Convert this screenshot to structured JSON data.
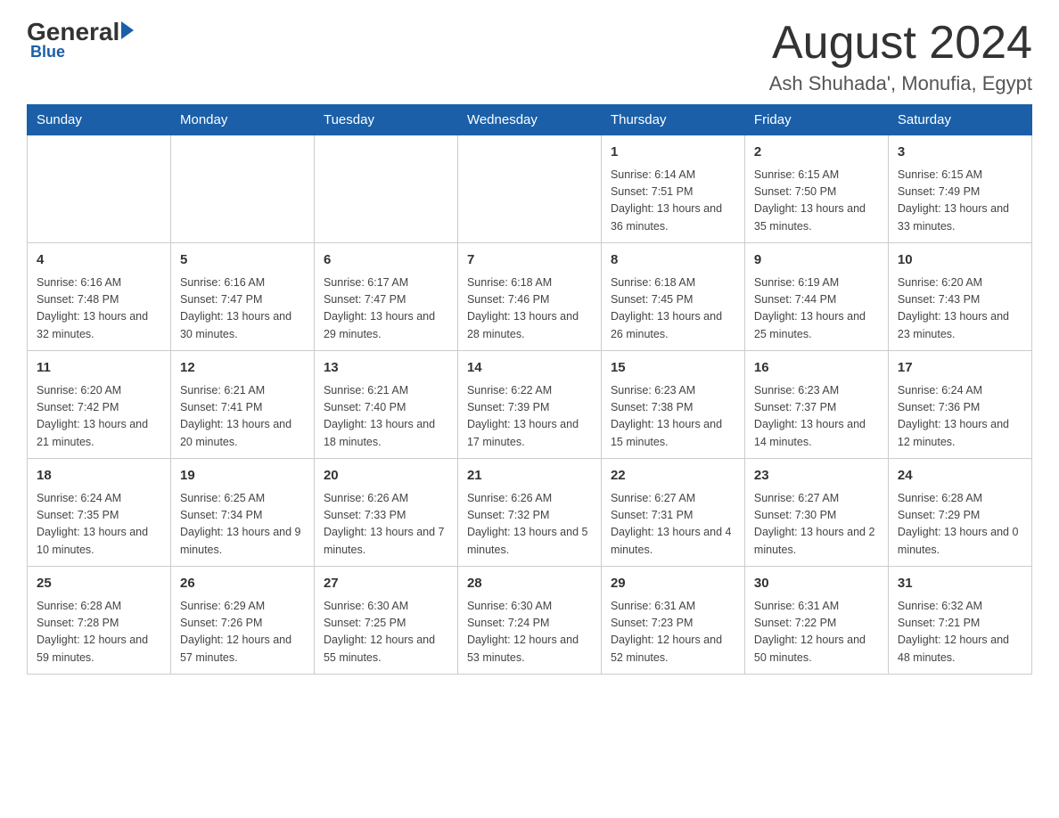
{
  "header": {
    "logo_general": "General",
    "logo_blue": "Blue",
    "month_title": "August 2024",
    "location": "Ash Shuhada', Monufia, Egypt"
  },
  "weekdays": [
    "Sunday",
    "Monday",
    "Tuesday",
    "Wednesday",
    "Thursday",
    "Friday",
    "Saturday"
  ],
  "weeks": [
    [
      {
        "day": "",
        "info": ""
      },
      {
        "day": "",
        "info": ""
      },
      {
        "day": "",
        "info": ""
      },
      {
        "day": "",
        "info": ""
      },
      {
        "day": "1",
        "info": "Sunrise: 6:14 AM\nSunset: 7:51 PM\nDaylight: 13 hours\nand 36 minutes."
      },
      {
        "day": "2",
        "info": "Sunrise: 6:15 AM\nSunset: 7:50 PM\nDaylight: 13 hours\nand 35 minutes."
      },
      {
        "day": "3",
        "info": "Sunrise: 6:15 AM\nSunset: 7:49 PM\nDaylight: 13 hours\nand 33 minutes."
      }
    ],
    [
      {
        "day": "4",
        "info": "Sunrise: 6:16 AM\nSunset: 7:48 PM\nDaylight: 13 hours\nand 32 minutes."
      },
      {
        "day": "5",
        "info": "Sunrise: 6:16 AM\nSunset: 7:47 PM\nDaylight: 13 hours\nand 30 minutes."
      },
      {
        "day": "6",
        "info": "Sunrise: 6:17 AM\nSunset: 7:47 PM\nDaylight: 13 hours\nand 29 minutes."
      },
      {
        "day": "7",
        "info": "Sunrise: 6:18 AM\nSunset: 7:46 PM\nDaylight: 13 hours\nand 28 minutes."
      },
      {
        "day": "8",
        "info": "Sunrise: 6:18 AM\nSunset: 7:45 PM\nDaylight: 13 hours\nand 26 minutes."
      },
      {
        "day": "9",
        "info": "Sunrise: 6:19 AM\nSunset: 7:44 PM\nDaylight: 13 hours\nand 25 minutes."
      },
      {
        "day": "10",
        "info": "Sunrise: 6:20 AM\nSunset: 7:43 PM\nDaylight: 13 hours\nand 23 minutes."
      }
    ],
    [
      {
        "day": "11",
        "info": "Sunrise: 6:20 AM\nSunset: 7:42 PM\nDaylight: 13 hours\nand 21 minutes."
      },
      {
        "day": "12",
        "info": "Sunrise: 6:21 AM\nSunset: 7:41 PM\nDaylight: 13 hours\nand 20 minutes."
      },
      {
        "day": "13",
        "info": "Sunrise: 6:21 AM\nSunset: 7:40 PM\nDaylight: 13 hours\nand 18 minutes."
      },
      {
        "day": "14",
        "info": "Sunrise: 6:22 AM\nSunset: 7:39 PM\nDaylight: 13 hours\nand 17 minutes."
      },
      {
        "day": "15",
        "info": "Sunrise: 6:23 AM\nSunset: 7:38 PM\nDaylight: 13 hours\nand 15 minutes."
      },
      {
        "day": "16",
        "info": "Sunrise: 6:23 AM\nSunset: 7:37 PM\nDaylight: 13 hours\nand 14 minutes."
      },
      {
        "day": "17",
        "info": "Sunrise: 6:24 AM\nSunset: 7:36 PM\nDaylight: 13 hours\nand 12 minutes."
      }
    ],
    [
      {
        "day": "18",
        "info": "Sunrise: 6:24 AM\nSunset: 7:35 PM\nDaylight: 13 hours\nand 10 minutes."
      },
      {
        "day": "19",
        "info": "Sunrise: 6:25 AM\nSunset: 7:34 PM\nDaylight: 13 hours\nand 9 minutes."
      },
      {
        "day": "20",
        "info": "Sunrise: 6:26 AM\nSunset: 7:33 PM\nDaylight: 13 hours\nand 7 minutes."
      },
      {
        "day": "21",
        "info": "Sunrise: 6:26 AM\nSunset: 7:32 PM\nDaylight: 13 hours\nand 5 minutes."
      },
      {
        "day": "22",
        "info": "Sunrise: 6:27 AM\nSunset: 7:31 PM\nDaylight: 13 hours\nand 4 minutes."
      },
      {
        "day": "23",
        "info": "Sunrise: 6:27 AM\nSunset: 7:30 PM\nDaylight: 13 hours\nand 2 minutes."
      },
      {
        "day": "24",
        "info": "Sunrise: 6:28 AM\nSunset: 7:29 PM\nDaylight: 13 hours\nand 0 minutes."
      }
    ],
    [
      {
        "day": "25",
        "info": "Sunrise: 6:28 AM\nSunset: 7:28 PM\nDaylight: 12 hours\nand 59 minutes."
      },
      {
        "day": "26",
        "info": "Sunrise: 6:29 AM\nSunset: 7:26 PM\nDaylight: 12 hours\nand 57 minutes."
      },
      {
        "day": "27",
        "info": "Sunrise: 6:30 AM\nSunset: 7:25 PM\nDaylight: 12 hours\nand 55 minutes."
      },
      {
        "day": "28",
        "info": "Sunrise: 6:30 AM\nSunset: 7:24 PM\nDaylight: 12 hours\nand 53 minutes."
      },
      {
        "day": "29",
        "info": "Sunrise: 6:31 AM\nSunset: 7:23 PM\nDaylight: 12 hours\nand 52 minutes."
      },
      {
        "day": "30",
        "info": "Sunrise: 6:31 AM\nSunset: 7:22 PM\nDaylight: 12 hours\nand 50 minutes."
      },
      {
        "day": "31",
        "info": "Sunrise: 6:32 AM\nSunset: 7:21 PM\nDaylight: 12 hours\nand 48 minutes."
      }
    ]
  ]
}
